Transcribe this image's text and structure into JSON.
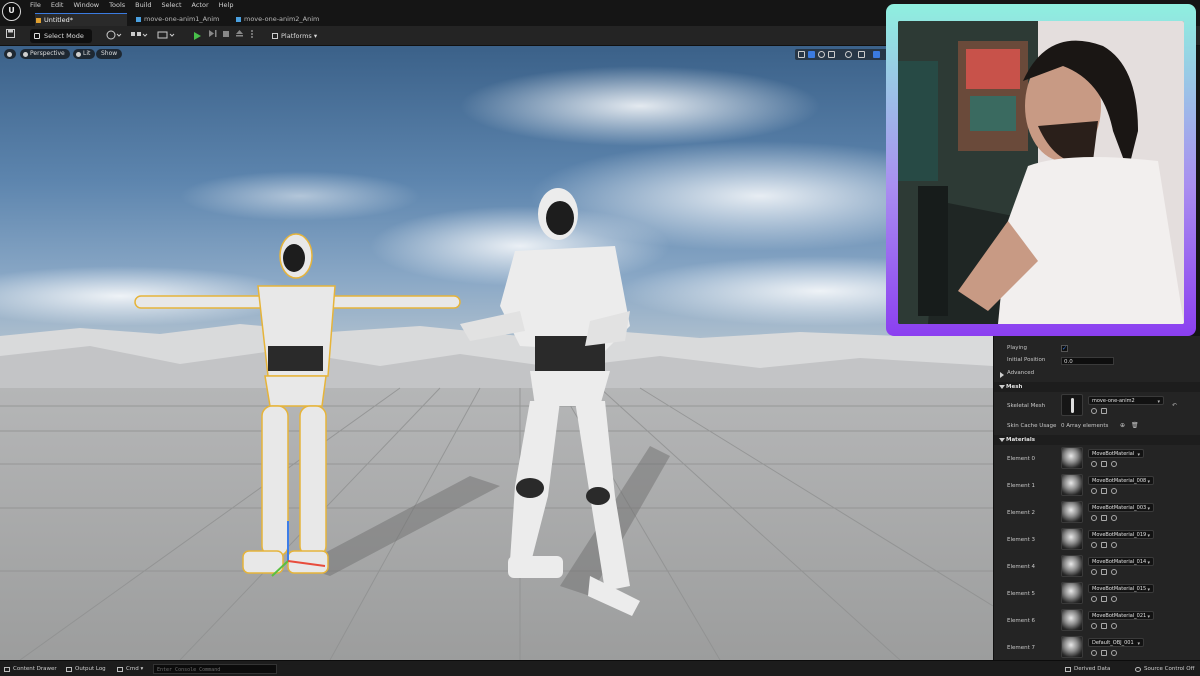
{
  "menu": [
    "File",
    "Edit",
    "Window",
    "Tools",
    "Build",
    "Select",
    "Actor",
    "Help"
  ],
  "tabs": [
    {
      "label": "Untitled*"
    },
    {
      "label": "move-one-anim1_Anim"
    },
    {
      "label": "move-one-anim2_Anim"
    }
  ],
  "toolbar": {
    "select_mode": "Select Mode",
    "platforms": "Platforms"
  },
  "viewport": {
    "perspective": "Perspective",
    "lit": "Lit",
    "show": "Show"
  },
  "details": {
    "playing_label": "Playing",
    "playing_checked": true,
    "initial_position_label": "Initial Position",
    "initial_position_value": "0.0",
    "advanced_label": "Advanced",
    "mesh_section": "Mesh",
    "skeletal_mesh_label": "Skeletal Mesh",
    "skeletal_mesh_value": "move-one-anim2",
    "skin_cache_label": "Skin Cache Usage",
    "skin_cache_value": "0 Array elements",
    "materials_section": "Materials",
    "elements": [
      {
        "label": "Element 0",
        "material": "MoveBotMaterial"
      },
      {
        "label": "Element 1",
        "material": "MoveBotMaterial_008"
      },
      {
        "label": "Element 2",
        "material": "MoveBotMaterial_003"
      },
      {
        "label": "Element 3",
        "material": "MoveBotMaterial_019"
      },
      {
        "label": "Element 4",
        "material": "MoveBotMaterial_014"
      },
      {
        "label": "Element 5",
        "material": "MoveBotMaterial_015"
      },
      {
        "label": "Element 6",
        "material": "MoveBotMaterial_021"
      },
      {
        "label": "Element 7",
        "material": "Default_OBJ_001"
      }
    ]
  },
  "statusbar": {
    "content_drawer": "Content Drawer",
    "output_log": "Output Log",
    "cmd": "Cmd",
    "console_placeholder": "Enter Console Command",
    "derived_data": "Derived Data",
    "source_control": "Source Control Off"
  },
  "colors": {
    "accent": "#3b7be0",
    "play_green": "#48c04a",
    "webcam_frame_top": "#8ff0df",
    "webcam_frame_bottom": "#8b3ff0",
    "selection_outline": "#e6b43a"
  }
}
